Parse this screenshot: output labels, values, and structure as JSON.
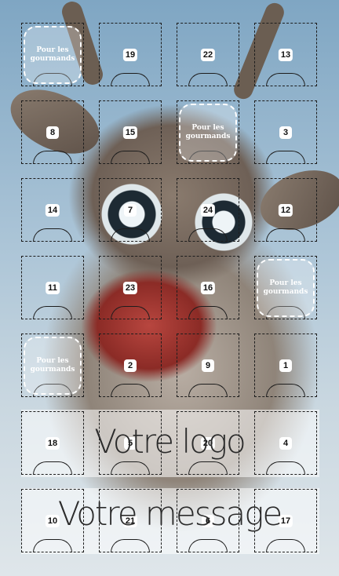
{
  "overlay": {
    "logo_text": "Votre logo",
    "message_text": "Votre message"
  },
  "badge_text": "Pour les gourmands",
  "doors": [
    {
      "id": "r1c1",
      "badge": true
    },
    {
      "id": "r1c2",
      "number": "19"
    },
    {
      "id": "r1c3",
      "number": "22"
    },
    {
      "id": "r1c4",
      "number": "13"
    },
    {
      "id": "r2c1",
      "number": "8"
    },
    {
      "id": "r2c2",
      "number": "15"
    },
    {
      "id": "r2c3",
      "badge": true
    },
    {
      "id": "r2c4",
      "number": "3"
    },
    {
      "id": "r3c1",
      "number": "14"
    },
    {
      "id": "r3c2",
      "number": "7"
    },
    {
      "id": "r3c3",
      "number": "24"
    },
    {
      "id": "r3c4",
      "number": "12"
    },
    {
      "id": "r4c1",
      "number": "11"
    },
    {
      "id": "r4c2",
      "number": "23"
    },
    {
      "id": "r4c3",
      "number": "16"
    },
    {
      "id": "r4c4",
      "badge": true
    },
    {
      "id": "r5c1",
      "badge": true
    },
    {
      "id": "r5c2",
      "number": "2"
    },
    {
      "id": "r5c3",
      "number": "9"
    },
    {
      "id": "r5c4",
      "number": "1"
    },
    {
      "id": "r6c1",
      "number": "18"
    },
    {
      "id": "r6c2",
      "number": "5"
    },
    {
      "id": "r6c3",
      "number": "20"
    },
    {
      "id": "r6c4",
      "number": "4"
    },
    {
      "id": "r7c1",
      "number": "10"
    },
    {
      "id": "r7c2",
      "number": "21"
    },
    {
      "id": "r7c3",
      "number": "6"
    },
    {
      "id": "r7c4",
      "number": "17"
    }
  ]
}
